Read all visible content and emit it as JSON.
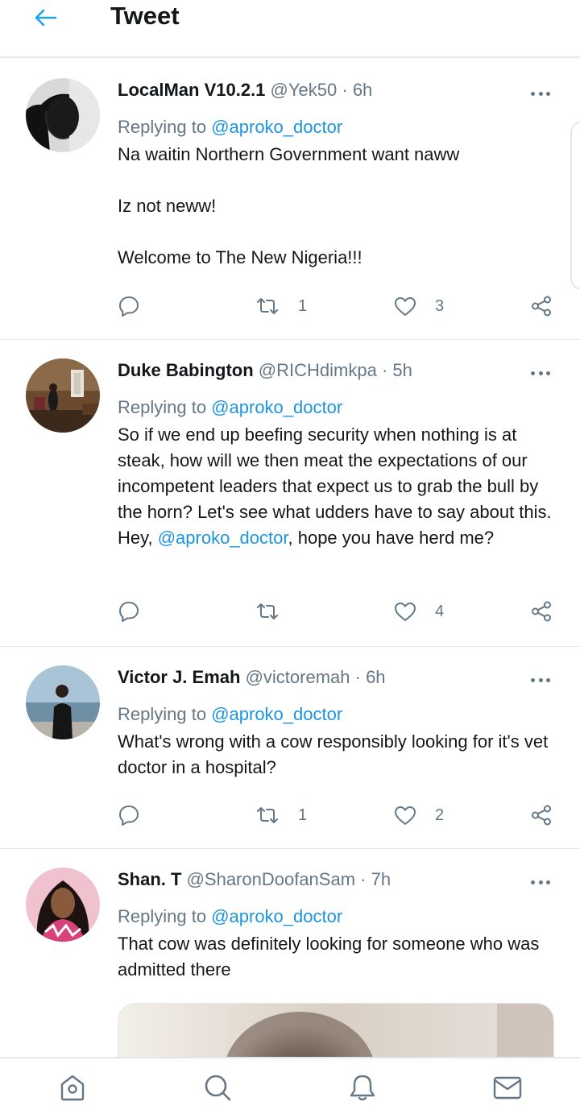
{
  "header": {
    "title": "Tweet",
    "back_icon": "arrow-left-icon",
    "accent": "#1da1f2"
  },
  "tweets": [
    {
      "name": "LocalMan V10.2.1",
      "handle": "@Yek50",
      "time": "· 6h",
      "replying_prefix": "Replying to ",
      "replying_to": "@aproko_doctor",
      "lines": [
        "Na waitin Northern Government want naww",
        "Iz not neww!",
        "Welcome to The New Nigeria!!!"
      ],
      "retweets": "1",
      "likes": "3"
    },
    {
      "name": "Duke Babington",
      "handle": "@RICHdimkpa",
      "time": "· 5h",
      "replying_prefix": "Replying to ",
      "replying_to": "@aproko_doctor",
      "text_before": "So if we end up beefing security when nothing is at steak, how will we then meat the expectations of our incompetent leaders that expect us to grab the bull by the horn? Let's see what udders have to say about this. Hey, ",
      "text_mention": "@aproko_doctor",
      "text_after": ", hope you have herd me?",
      "retweets": "",
      "likes": "4"
    },
    {
      "name": "Victor J. Emah",
      "handle": "@victoremah",
      "time": "· 6h",
      "replying_prefix": "Replying to ",
      "replying_to": "@aproko_doctor",
      "text": "What's wrong with a cow responsibly looking for it's vet doctor in a hospital?",
      "retweets": "1",
      "likes": "2"
    },
    {
      "name": "Shan. T",
      "handle": "@SharonDoofanSam",
      "time": "· 7h",
      "replying_prefix": "Replying to ",
      "replying_to": "@aproko_doctor",
      "text": "That cow was definitely looking for someone who was admitted there"
    }
  ],
  "icons": {
    "reply": "reply-icon",
    "retweet": "retweet-icon",
    "like": "heart-icon",
    "share": "share-icon",
    "more": "more-options-icon"
  },
  "bottom_nav": [
    "home-icon",
    "search-icon",
    "notifications-icon",
    "messages-icon"
  ],
  "colors": {
    "accent": "#1da1f2",
    "mention": "#1b95e0",
    "muted": "#657786",
    "text": "#14171a",
    "divider": "#e1e8ed"
  }
}
